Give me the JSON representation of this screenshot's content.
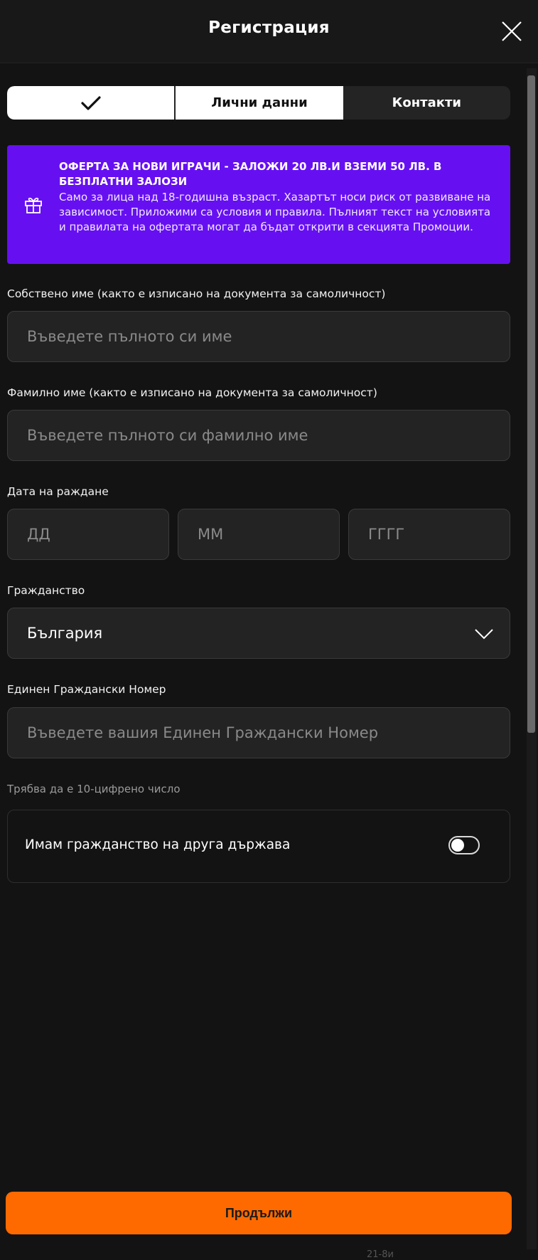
{
  "header": {
    "title": "Регистрация",
    "close_icon": "close-icon"
  },
  "steps": [
    {
      "label": "✔",
      "icon": "checkmark-icon",
      "state": "done"
    },
    {
      "label": "Лични данни",
      "state": "current"
    },
    {
      "label": "Контакти",
      "state": "next"
    }
  ],
  "promo": {
    "icon": "gift-icon",
    "title": "ОФЕРТА ЗА НОВИ ИГРАЧИ - ЗАЛОЖИ 20 ЛВ.И ВЗЕМИ 50 ЛВ. В БЕЗПЛАТНИ ЗАЛОЗИ",
    "text": "Само за лица над 18-годишна възраст. Хазартът носи риск от развиване на зависимост. Приложими са условия и правила. Пълният текст на условията и правилата на офертата могат да бъдат открити в секцията Промоции.",
    "color": "#6610f2"
  },
  "form": {
    "first_name": {
      "label": "Собствено име (както е изписано на документа за самоличност)",
      "placeholder": "Въведете пълното си име"
    },
    "last_name": {
      "label": "Фамилно име (както е изписано на документа за самоличност)",
      "placeholder": "Въведете пълното си фамилно име"
    },
    "dob": {
      "label": "Дата на раждане",
      "day_placeholder": "ДД",
      "month_placeholder": "ММ",
      "year_placeholder": "ГГГГ"
    },
    "citizenship": {
      "label": "Гражданство",
      "value": "България",
      "icon": "chevron-down-icon"
    },
    "egn": {
      "label": "Единен Граждански Номер",
      "placeholder": "Въведете вашия Единен Граждански Номер",
      "hint": "Трябва да е 10-цифрено число"
    },
    "dual_citizenship": {
      "label": "Имам гражданство на друга държава",
      "enabled": false
    }
  },
  "continue_label": "Продължи",
  "footer_text": "21-8и",
  "colors": {
    "accent": "#ff6a00",
    "promo": "#6610f2",
    "background": "#131313"
  }
}
